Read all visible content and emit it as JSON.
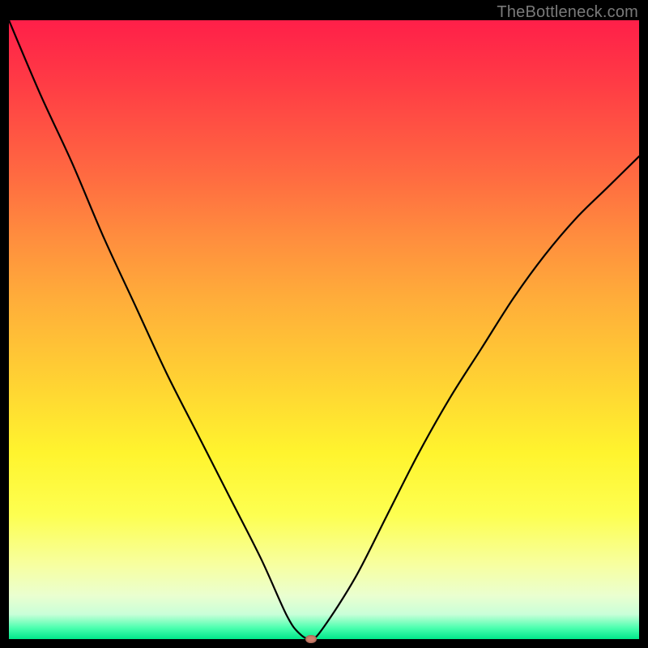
{
  "watermark": "TheBottleneck.com",
  "chart_data": {
    "type": "line",
    "title": "",
    "xlabel": "",
    "ylabel": "",
    "xlim": [
      0,
      100
    ],
    "ylim": [
      0,
      100
    ],
    "grid": false,
    "legend": false,
    "series": [
      {
        "name": "bottleneck-curve",
        "x": [
          0,
          5,
          10,
          15,
          20,
          25,
          30,
          35,
          40,
          44,
          46,
          48,
          50,
          55,
          60,
          65,
          70,
          75,
          80,
          85,
          90,
          95,
          100
        ],
        "y": [
          100,
          88,
          77,
          65,
          54,
          43,
          33,
          23,
          13,
          4,
          1,
          0,
          2,
          10,
          20,
          30,
          39,
          47,
          55,
          62,
          68,
          73,
          78
        ]
      }
    ],
    "marker": {
      "x": 48,
      "y": 0,
      "color": "#d07f6c"
    },
    "background_gradient": {
      "stops": [
        {
          "pos": 0,
          "color": "#ff1f49"
        },
        {
          "pos": 25,
          "color": "#ff6a41"
        },
        {
          "pos": 50,
          "color": "#ffad3a"
        },
        {
          "pos": 70,
          "color": "#fff42e"
        },
        {
          "pos": 90,
          "color": "#eaffd0"
        },
        {
          "pos": 100,
          "color": "#00e88a"
        }
      ]
    }
  }
}
